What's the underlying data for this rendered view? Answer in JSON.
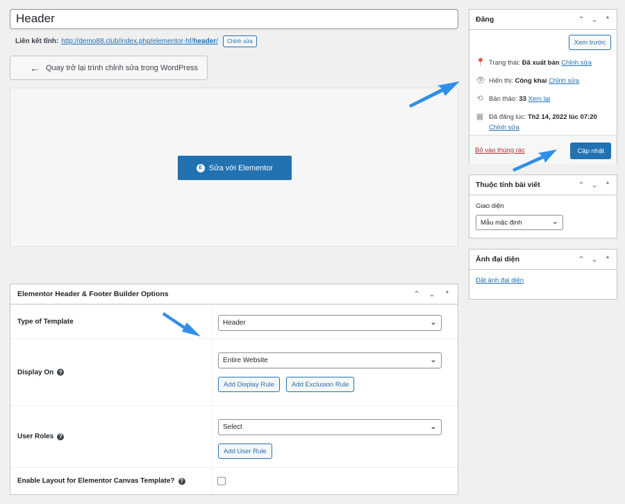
{
  "title_value": "Header",
  "permalink": {
    "label": "Liên kết tĩnh:",
    "url_prefix": "http://demo88.club/index.php/elementor-hf/",
    "url_slug": "header",
    "url_suffix": "/",
    "edit_button": "Chỉnh sửa"
  },
  "back_button": "Quay trở lại trình chỉnh sửa trong WordPress",
  "elementor_button": "Sửa với Elementor",
  "options_box": {
    "title": "Elementor Header & Footer Builder Options",
    "rows": {
      "type_label": "Type of Template",
      "type_value": "Header",
      "display_label": "Display On",
      "display_value": "Entire Website",
      "add_display_rule": "Add Display Rule",
      "add_exclusion_rule": "Add Exclusion Rule",
      "roles_label": "User Roles",
      "roles_value": "Select",
      "add_user_rule": "Add User Rule",
      "canvas_label": "Enable Layout for Elementor Canvas Template?"
    }
  },
  "publish_box": {
    "title": "Đăng",
    "preview_button": "Xem trước",
    "status_label": "Trạng thái:",
    "status_value": "Đã xuất bản",
    "status_edit": "Chỉnh sửa",
    "visibility_label": "Hiển thị:",
    "visibility_value": "Công khai",
    "visibility_edit": "Chỉnh sửa",
    "revisions_label": "Bản thảo:",
    "revisions_value": "33",
    "revisions_link": "Xem lại",
    "published_label": "Đã đăng lúc:",
    "published_value": "Th2 14, 2022 lúc 07:20",
    "published_edit": "Chỉnh sửa",
    "trash_link": "Bỏ vào thùng rác",
    "update_button": "Cập nhật"
  },
  "attributes_box": {
    "title": "Thuộc tính bài viết",
    "template_label": "Giao diện",
    "template_value": "Mẫu mặc định"
  },
  "featured_box": {
    "title": "Ảnh đại diện",
    "set_link": "Đặt ảnh đại diện"
  },
  "colors": {
    "primary": "#2271b1",
    "trash": "#b32d2e",
    "annotation": "#2f8fe8"
  }
}
